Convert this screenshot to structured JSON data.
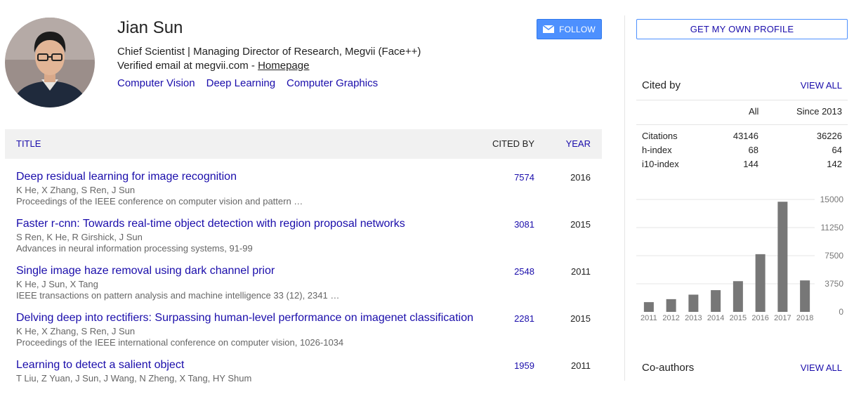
{
  "profile": {
    "name": "Jian Sun",
    "affiliation": "Chief Scientist | Managing Director of Research, Megvii (Face++)",
    "email_prefix": "Verified email at megvii.com - ",
    "homepage_label": "Homepage",
    "interests": [
      "Computer Vision",
      "Deep Learning",
      "Computer Graphics"
    ]
  },
  "buttons": {
    "follow": "FOLLOW",
    "get_profile": "GET MY OWN PROFILE"
  },
  "table": {
    "headers": {
      "title": "TITLE",
      "cited_by": "CITED BY",
      "year": "YEAR"
    },
    "rows": [
      {
        "title": "Deep residual learning for image recognition",
        "authors": "K He, X Zhang, S Ren, J Sun",
        "venue": "Proceedings of the IEEE conference on computer vision and pattern …",
        "cited": "7574",
        "year": "2016"
      },
      {
        "title": "Faster r-cnn: Towards real-time object detection with region proposal networks",
        "authors": "S Ren, K He, R Girshick, J Sun",
        "venue": "Advances in neural information processing systems, 91-99",
        "cited": "3081",
        "year": "2015"
      },
      {
        "title": "Single image haze removal using dark channel prior",
        "authors": "K He, J Sun, X Tang",
        "venue": "IEEE transactions on pattern analysis and machine intelligence 33 (12), 2341 …",
        "cited": "2548",
        "year": "2011"
      },
      {
        "title": "Delving deep into rectifiers: Surpassing human-level performance on imagenet classification",
        "authors": "K He, X Zhang, S Ren, J Sun",
        "venue": "Proceedings of the IEEE international conference on computer vision, 1026-1034",
        "cited": "2281",
        "year": "2015"
      },
      {
        "title": "Learning to detect a salient object",
        "authors": "T Liu, Z Yuan, J Sun, J Wang, N Zheng, X Tang, HY Shum",
        "venue": "",
        "cited": "1959",
        "year": "2011"
      }
    ]
  },
  "cited_by": {
    "heading": "Cited by",
    "view_all": "VIEW ALL",
    "col_all": "All",
    "col_since": "Since 2013",
    "rows": [
      {
        "label": "Citations",
        "all": "43146",
        "since": "36226"
      },
      {
        "label": "h-index",
        "all": "68",
        "since": "64"
      },
      {
        "label": "i10-index",
        "all": "144",
        "since": "142"
      }
    ]
  },
  "chart_data": {
    "type": "bar",
    "categories": [
      "2011",
      "2012",
      "2013",
      "2014",
      "2015",
      "2016",
      "2017",
      "2018"
    ],
    "values": [
      1300,
      1700,
      2300,
      2900,
      4100,
      7700,
      14700,
      4200
    ],
    "y_ticks": [
      "15000",
      "11250",
      "7500",
      "3750",
      "0"
    ],
    "ylim": [
      0,
      15000
    ],
    "grid": true,
    "bar_color": "#777777"
  },
  "coauthors": {
    "heading": "Co-authors",
    "view_all": "VIEW ALL"
  },
  "colors": {
    "link": "#1a0dab",
    "follow_bg": "#4d90fe",
    "header_bg": "#f1f1f1"
  }
}
